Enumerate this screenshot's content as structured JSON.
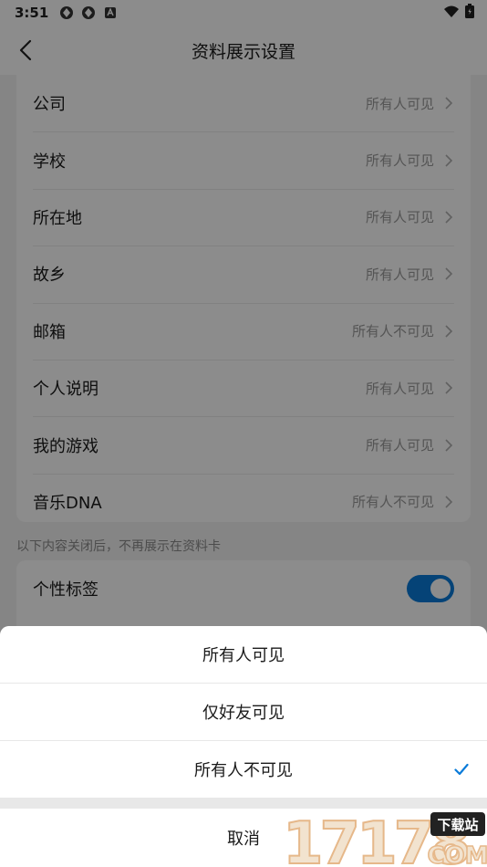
{
  "status_bar": {
    "time": "3:51"
  },
  "nav": {
    "title": "资料展示设置"
  },
  "settings": {
    "rows": [
      {
        "label": "公司",
        "value": "所有人可见"
      },
      {
        "label": "学校",
        "value": "所有人可见"
      },
      {
        "label": "所在地",
        "value": "所有人可见"
      },
      {
        "label": "故乡",
        "value": "所有人可见"
      },
      {
        "label": "邮箱",
        "value": "所有人不可见"
      },
      {
        "label": "个人说明",
        "value": "所有人可见"
      },
      {
        "label": "我的游戏",
        "value": "所有人可见"
      },
      {
        "label": "音乐DNA",
        "value": "所有人不可见"
      }
    ]
  },
  "section_note": "以下内容关闭后，不再展示在资料卡",
  "toggles": [
    {
      "label": "个性标签",
      "on": true
    }
  ],
  "sheet": {
    "options": [
      {
        "label": "所有人可见",
        "selected": false
      },
      {
        "label": "仅好友可见",
        "selected": false
      },
      {
        "label": "所有人不可见",
        "selected": true
      }
    ],
    "cancel": "取消"
  },
  "watermark": {
    "number": "17178",
    "badge": "下载站",
    "domain": "COM"
  },
  "colors": {
    "accent": "#0a7bd9",
    "overlay": "rgba(0,0,0,0.45)"
  }
}
